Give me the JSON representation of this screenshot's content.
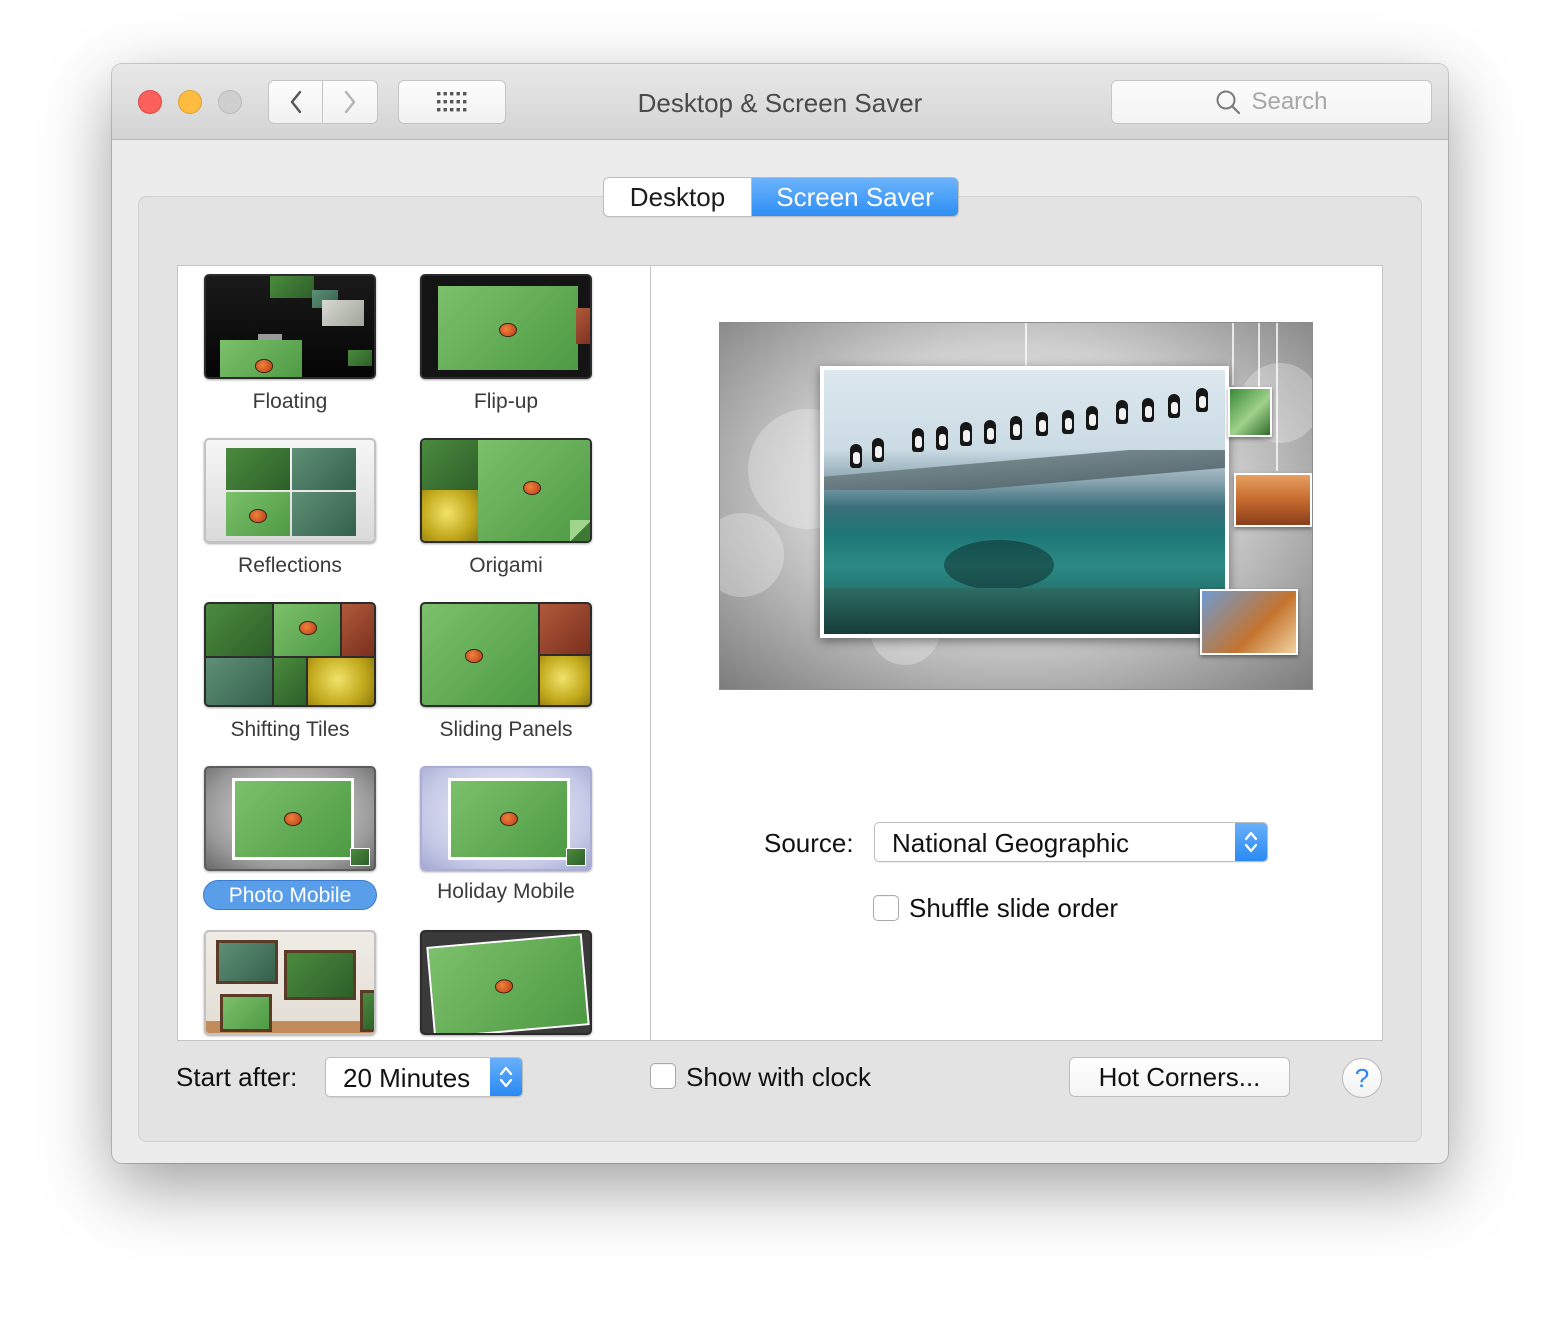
{
  "window": {
    "title": "Desktop & Screen Saver",
    "search_placeholder": "Search"
  },
  "tabs": [
    {
      "label": "Desktop",
      "selected": false
    },
    {
      "label": "Screen Saver",
      "selected": true
    }
  ],
  "screensavers": [
    {
      "label": "Floating",
      "selected": false
    },
    {
      "label": "Flip-up",
      "selected": false
    },
    {
      "label": "Reflections",
      "selected": false
    },
    {
      "label": "Origami",
      "selected": false
    },
    {
      "label": "Shifting Tiles",
      "selected": false
    },
    {
      "label": "Sliding Panels",
      "selected": false
    },
    {
      "label": "Photo Mobile",
      "selected": true
    },
    {
      "label": "Holiday Mobile",
      "selected": false
    }
  ],
  "options": {
    "source_label": "Source:",
    "source_value": "National Geographic",
    "shuffle_label": "Shuffle slide order",
    "shuffle_checked": false
  },
  "bottom": {
    "start_after_label": "Start after:",
    "start_after_value": "20 Minutes",
    "show_clock_label": "Show with clock",
    "show_clock_checked": false,
    "hot_corners_label": "Hot Corners...",
    "help_label": "?"
  },
  "colors": {
    "accent": "#2d8ef5",
    "selection": "#5a9de8",
    "close": "#fc605c",
    "minimize": "#fdbc40",
    "zoom_disabled": "#cfcfcf"
  }
}
